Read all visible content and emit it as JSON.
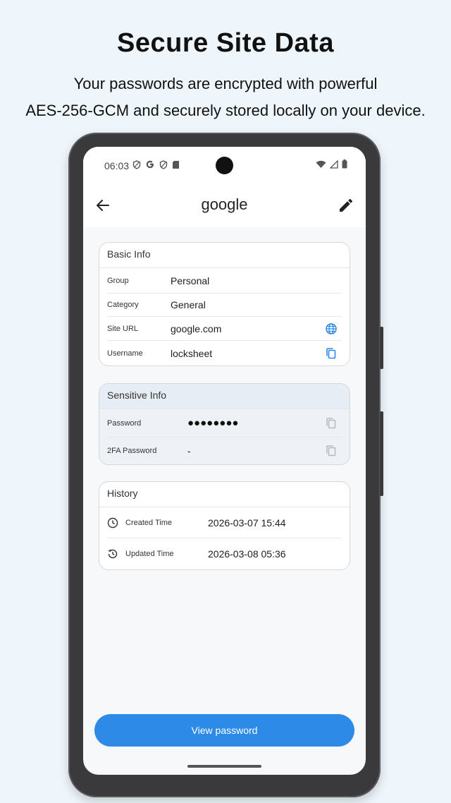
{
  "promo": {
    "title": "Secure Site Data",
    "subtitle_line1": "Your passwords are encrypted with powerful",
    "subtitle_line2": "AES-256-GCM and securely stored locally on your device."
  },
  "statusbar": {
    "time": "06:03",
    "left_icons": [
      "shield-icon",
      "google-g-icon",
      "shield-icon",
      "sd-card-icon"
    ],
    "right_icons": [
      "wifi-icon",
      "signal-icon",
      "battery-icon"
    ]
  },
  "appbar": {
    "title": "google",
    "back_icon": "arrow-left-icon",
    "edit_icon": "pencil-icon"
  },
  "basic_info": {
    "header": "Basic Info",
    "rows": [
      {
        "label": "Group",
        "value": "Personal"
      },
      {
        "label": "Category",
        "value": "General"
      },
      {
        "label": "Site URL",
        "value": "google.com",
        "action_icon": "globe-icon"
      },
      {
        "label": "Username",
        "value": "locksheet",
        "action_icon": "copy-icon"
      }
    ]
  },
  "sensitive_info": {
    "header": "Sensitive Info",
    "rows": [
      {
        "label": "Password",
        "value": "●●●●●●●●",
        "action_icon": "copy-icon"
      },
      {
        "label": "2FA Password",
        "value": "-",
        "action_icon": "copy-icon"
      }
    ]
  },
  "history": {
    "header": "History",
    "rows": [
      {
        "label": "Created Time",
        "value": "2026-03-07 15:44",
        "icon": "clock-icon"
      },
      {
        "label": "Updated Time",
        "value": "2026-03-08 05:36",
        "icon": "history-icon"
      }
    ]
  },
  "actions": {
    "view_password_label": "View password"
  },
  "colors": {
    "accent": "#2d8ae6",
    "background": "#eef6fb",
    "phone_frame": "#3a3a3c"
  }
}
